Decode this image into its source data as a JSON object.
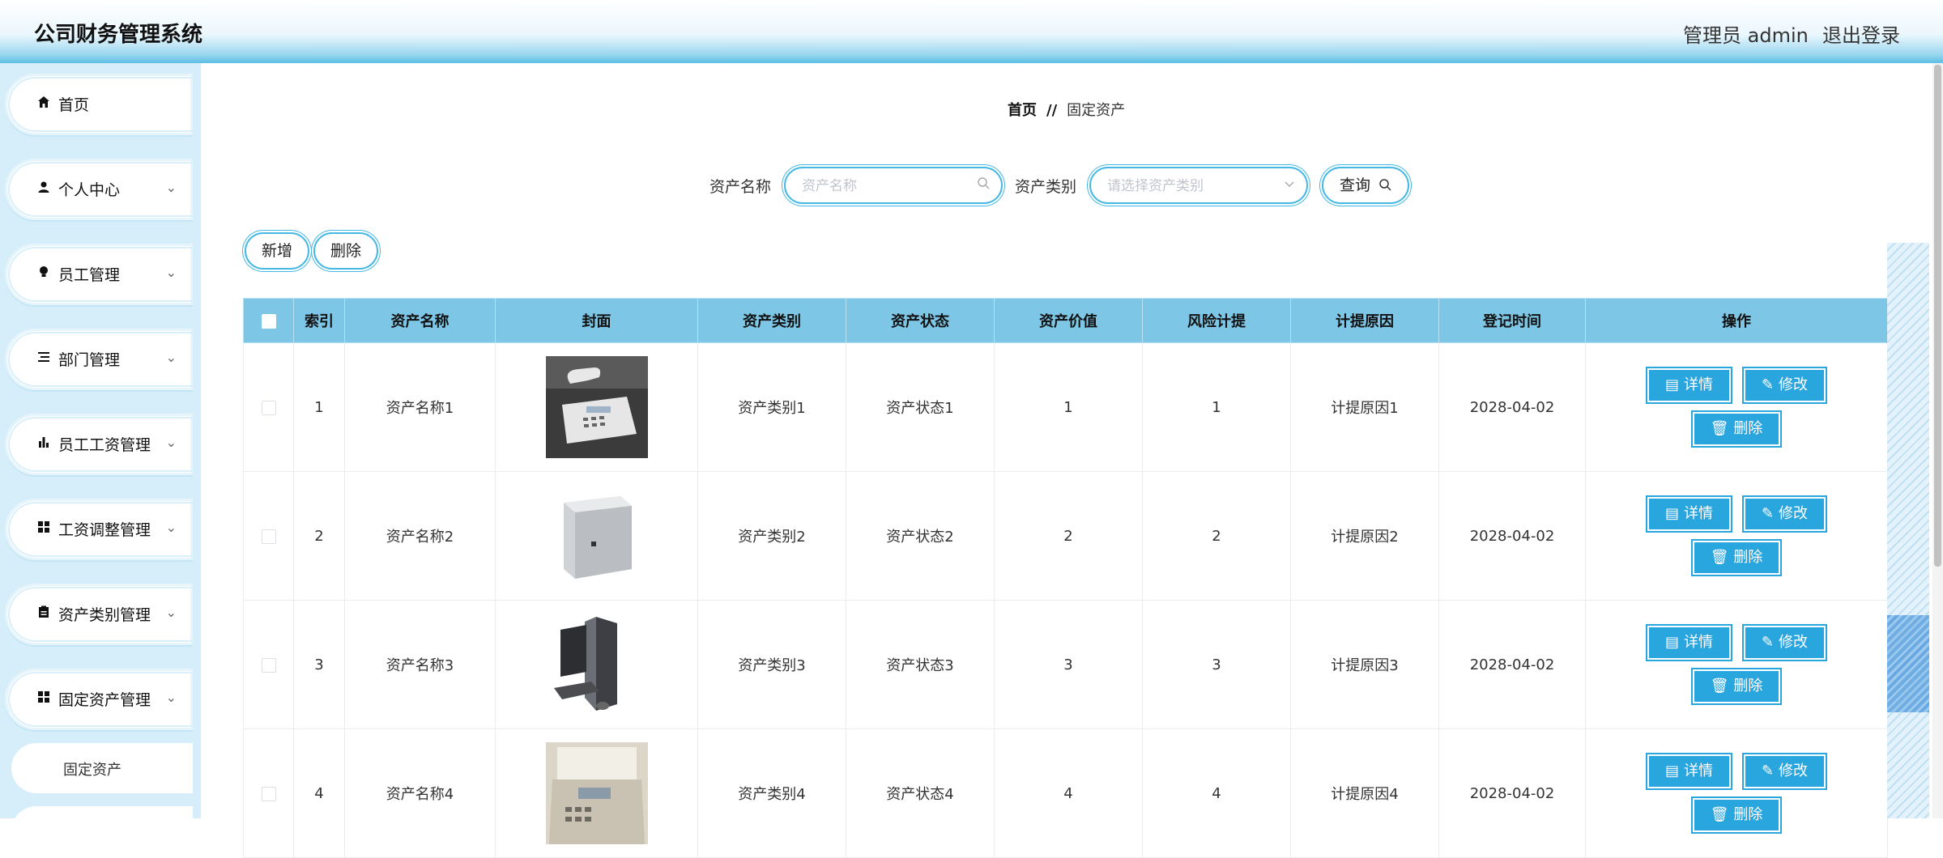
{
  "header": {
    "title": "公司财务管理系统",
    "admin": "管理员 admin",
    "logout": "退出登录"
  },
  "sidebar": {
    "items": [
      {
        "label": "首页",
        "icon": "home-icon",
        "glyph": "⌂"
      },
      {
        "label": "个人中心",
        "icon": "user-icon",
        "glyph": "●"
      },
      {
        "label": "员工管理",
        "icon": "bulb-icon",
        "glyph": "●"
      },
      {
        "label": "部门管理",
        "icon": "list-icon",
        "glyph": "☰"
      },
      {
        "label": "员工工资管理",
        "icon": "bar-chart-icon",
        "glyph": "▮"
      },
      {
        "label": "工资调整管理",
        "icon": "grid-icon",
        "glyph": "▦"
      },
      {
        "label": "资产类别管理",
        "icon": "clipboard-icon",
        "glyph": "▤"
      },
      {
        "label": "固定资产管理",
        "icon": "grid-icon",
        "glyph": "▦"
      }
    ],
    "sub_item": "固定资产"
  },
  "breadcrumb": {
    "home": "首页",
    "sep": "//",
    "current": "固定资产"
  },
  "search": {
    "name_label": "资产名称",
    "name_placeholder": "资产名称",
    "type_label": "资产类别",
    "type_placeholder": "请选择资产类别",
    "query": "查询"
  },
  "toolbar": {
    "add": "新增",
    "delete": "删除"
  },
  "table": {
    "headers": [
      "",
      "索引",
      "资产名称",
      "封面",
      "资产类别",
      "资产状态",
      "资产价值",
      "风险计提",
      "计提原因",
      "登记时间",
      "操作"
    ],
    "actions": {
      "detail": "详情",
      "edit": "修改",
      "delete": "删除"
    },
    "rows": [
      {
        "index": "1",
        "name": "资产名称1",
        "image": "telephone",
        "type": "资产类别1",
        "status": "资产状态1",
        "value": "1",
        "risk": "1",
        "reason": "计提原因1",
        "date": "2028-04-02"
      },
      {
        "index": "2",
        "name": "资产名称2",
        "image": "printer",
        "type": "资产类别2",
        "status": "资产状态2",
        "value": "2",
        "risk": "2",
        "reason": "计提原因2",
        "date": "2028-04-02"
      },
      {
        "index": "3",
        "name": "资产名称3",
        "image": "computer",
        "type": "资产类别3",
        "status": "资产状态3",
        "value": "3",
        "risk": "3",
        "reason": "计提原因3",
        "date": "2028-04-02"
      },
      {
        "index": "4",
        "name": "资产名称4",
        "image": "fax-machine",
        "type": "资产类别4",
        "status": "资产状态4",
        "value": "4",
        "risk": "4",
        "reason": "计提原因4",
        "date": "2028-04-02"
      }
    ]
  },
  "colors": {
    "accent": "#2aa6df",
    "header_row": "#7dc6e6",
    "sidebar_bg": "#d6eef9"
  }
}
